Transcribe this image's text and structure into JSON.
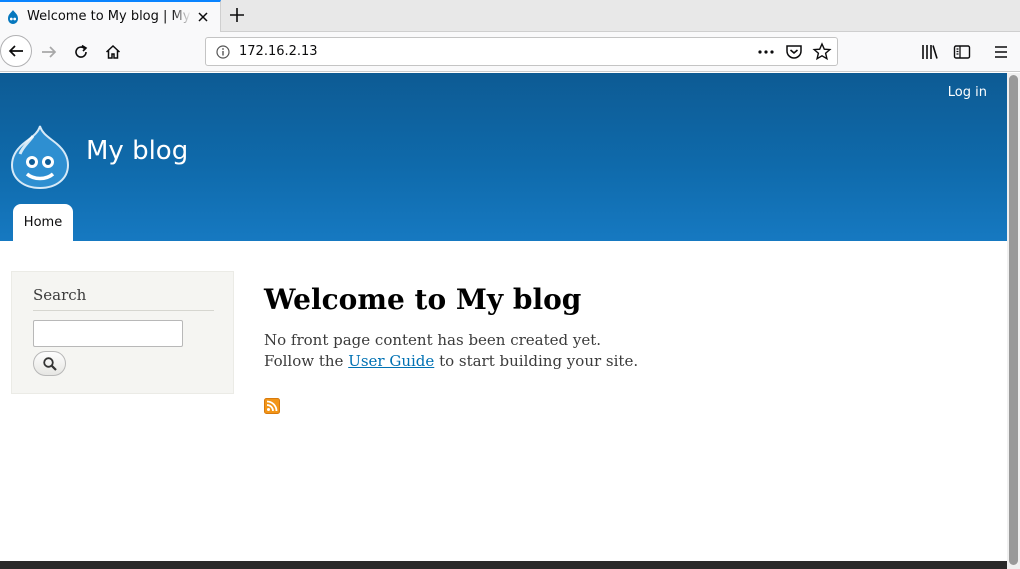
{
  "browser": {
    "tab_title": "Welcome to My blog | My blog",
    "url": "172.16.2.13"
  },
  "site": {
    "name": "My blog",
    "login_link": "Log in",
    "nav_home": "Home"
  },
  "sidebar": {
    "search_title": "Search",
    "search_value": ""
  },
  "content": {
    "title": "Welcome to My blog",
    "line1": "No front page content has been created yet.",
    "line2_before": "Follow the",
    "line2_link": "User Guide",
    "line2_after": "to start building your site."
  },
  "colors": {
    "header": "#0f6aab",
    "link": "#0071b3",
    "rss": "#f29517"
  }
}
